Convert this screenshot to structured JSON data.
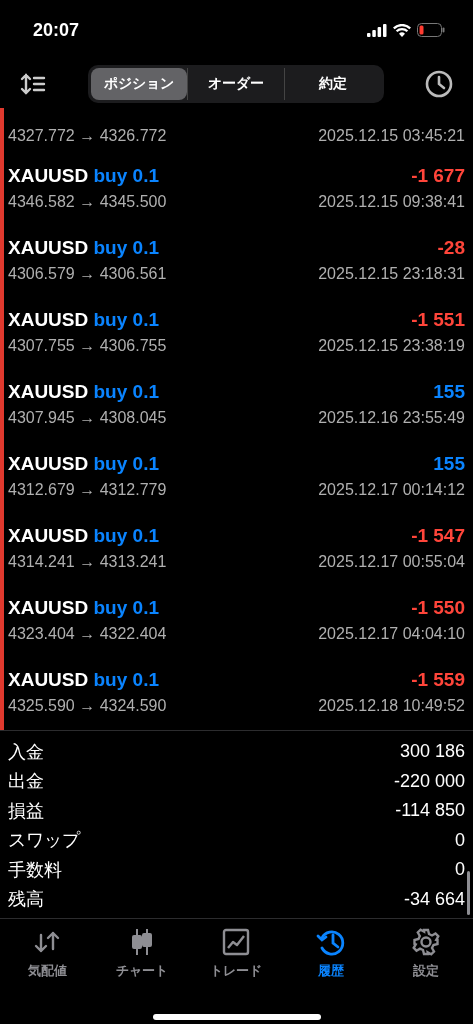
{
  "status_bar": {
    "time": "20:07"
  },
  "segments": [
    {
      "label": "ポジション",
      "selected": true
    },
    {
      "label": "オーダー",
      "selected": false
    },
    {
      "label": "約定",
      "selected": false
    }
  ],
  "partial_deal": {
    "prices": "4327.772 → 4326.772",
    "time": "2025.12.15 03:45:21"
  },
  "deals": [
    {
      "symbol": "XAUUSD",
      "side": "buy 0.1",
      "profit": "-1 677",
      "kind": "loss",
      "prices": "4346.582 → 4345.500",
      "time": "2025.12.15 09:38:41"
    },
    {
      "symbol": "XAUUSD",
      "side": "buy 0.1",
      "profit": "-28",
      "kind": "loss",
      "prices": "4306.579 → 4306.561",
      "time": "2025.12.15 23:18:31"
    },
    {
      "symbol": "XAUUSD",
      "side": "buy 0.1",
      "profit": "-1 551",
      "kind": "loss",
      "prices": "4307.755 → 4306.755",
      "time": "2025.12.15 23:38:19"
    },
    {
      "symbol": "XAUUSD",
      "side": "buy 0.1",
      "profit": "155",
      "kind": "profit",
      "prices": "4307.945 → 4308.045",
      "time": "2025.12.16 23:55:49"
    },
    {
      "symbol": "XAUUSD",
      "side": "buy 0.1",
      "profit": "155",
      "kind": "profit",
      "prices": "4312.679 → 4312.779",
      "time": "2025.12.17 00:14:12"
    },
    {
      "symbol": "XAUUSD",
      "side": "buy 0.1",
      "profit": "-1 547",
      "kind": "loss",
      "prices": "4314.241 → 4313.241",
      "time": "2025.12.17 00:55:04"
    },
    {
      "symbol": "XAUUSD",
      "side": "buy 0.1",
      "profit": "-1 550",
      "kind": "loss",
      "prices": "4323.404 → 4322.404",
      "time": "2025.12.17 04:04:10"
    },
    {
      "symbol": "XAUUSD",
      "side": "buy 0.1",
      "profit": "-1 559",
      "kind": "loss",
      "prices": "4325.590 → 4324.590",
      "time": "2025.12.18 10:49:52"
    }
  ],
  "summary": [
    {
      "label": "入金",
      "value": "300 186"
    },
    {
      "label": "出金",
      "value": "-220 000"
    },
    {
      "label": "損益",
      "value": "-114 850"
    },
    {
      "label": "スワップ",
      "value": "0"
    },
    {
      "label": "手数料",
      "value": "0"
    },
    {
      "label": "残高",
      "value": "-34 664"
    }
  ],
  "tab_bar": [
    {
      "label": "気配値",
      "kind": "arrows",
      "selected": false
    },
    {
      "label": "チャート",
      "kind": "candles",
      "selected": false
    },
    {
      "label": "トレード",
      "kind": "trade",
      "selected": false
    },
    {
      "label": "履歴",
      "kind": "history",
      "selected": true
    },
    {
      "label": "設定",
      "kind": "gear",
      "selected": false
    }
  ]
}
